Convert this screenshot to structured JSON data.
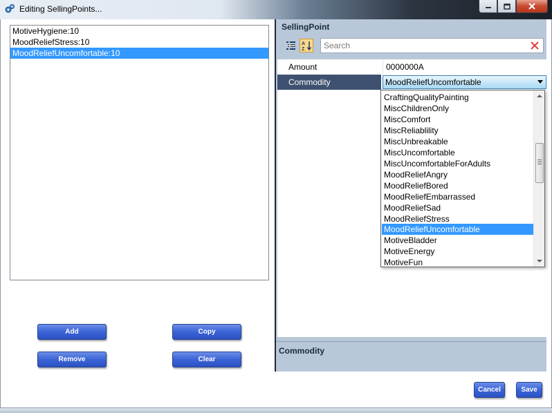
{
  "window": {
    "title": "Editing SellingPoints...",
    "icons": {
      "app": "app-gear-icon",
      "minimize": "minimize-icon",
      "maximize": "maximize-icon",
      "close": "close-icon"
    }
  },
  "selling_points": {
    "items": [
      {
        "label": "MotiveHygiene:10",
        "selected": false
      },
      {
        "label": "MoodReliefStress:10",
        "selected": false
      },
      {
        "label": "MoodReliefUncomfortable:10",
        "selected": true
      }
    ]
  },
  "buttons": {
    "add": "Add",
    "copy": "Copy",
    "remove": "Remove",
    "clear": "Clear",
    "cancel": "Cancel",
    "save": "Save"
  },
  "property_grid": {
    "title": "SellingPoint",
    "search_placeholder": "Search",
    "rows": [
      {
        "label": "Amount",
        "value": "0000000A"
      },
      {
        "label": "Commodity",
        "value": "MoodReliefUncomfortable"
      }
    ],
    "description_title": "Commodity",
    "colors": {
      "panel": "#b9c8d9",
      "selected_label": "#3e5170",
      "selection": "#3399ff"
    }
  },
  "commodity_dropdown": {
    "selected": "MoodReliefUncomfortable",
    "options": [
      "CraftingQualityPainting",
      "MiscChildrenOnly",
      "MiscComfort",
      "MiscReliablility",
      "MiscUnbreakable",
      "MiscUncomfortable",
      "MiscUncomfortableForAdults",
      "MoodReliefAngry",
      "MoodReliefBored",
      "MoodReliefEmbarrassed",
      "MoodReliefSad",
      "MoodReliefStress",
      "MoodReliefUncomfortable",
      "MotiveBladder",
      "MotiveEnergy",
      "MotiveFun"
    ]
  }
}
